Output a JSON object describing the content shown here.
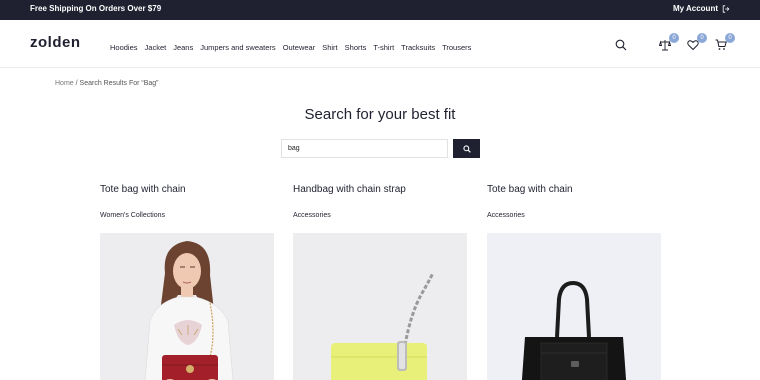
{
  "topbar": {
    "promo": "Free Shipping On Orders Over $79",
    "account": "My Account"
  },
  "header": {
    "logo": "zolden",
    "nav": [
      "Hoodies",
      "Jacket",
      "Jeans",
      "Jumpers and sweaters",
      "Outewear",
      "Shirt",
      "Shorts",
      "T-shirt",
      "Tracksuits",
      "Trousers"
    ],
    "badges": {
      "compare": "0",
      "wishlist": "0",
      "cart": "0"
    }
  },
  "breadcrumb": {
    "home": "Home",
    "current": "/ Search Results For “Bag”"
  },
  "page": {
    "title": "Search for your best fit"
  },
  "search": {
    "value": "bag"
  },
  "products": [
    {
      "name": "Tote bag with chain",
      "category": "Women's Collections"
    },
    {
      "name": "Handbag with chain strap",
      "category": "Accessories"
    },
    {
      "name": "Tote bag with chain",
      "category": "Accessories"
    }
  ],
  "icons": {
    "account": "logout-icon",
    "search": "search-icon",
    "compare": "compare-scale-icon",
    "wishlist": "heart-icon",
    "cart": "cart-icon",
    "search_button": "search-icon"
  },
  "colors": {
    "dark": "#1f2130",
    "badge": "#8aa7d8"
  }
}
